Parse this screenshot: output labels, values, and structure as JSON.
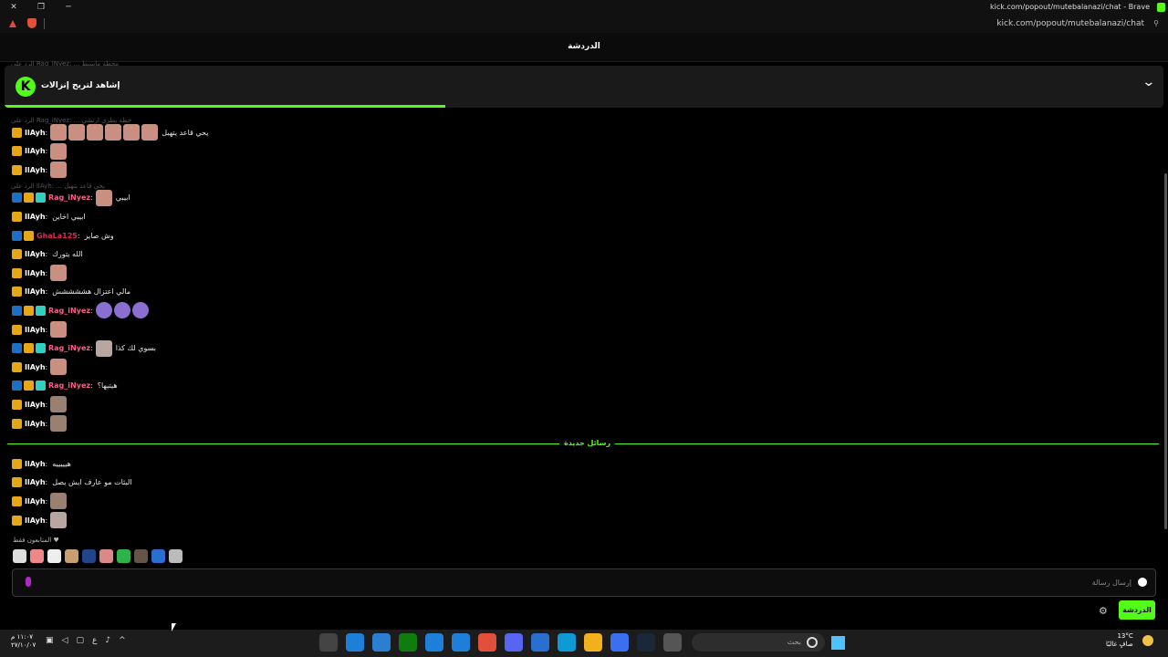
{
  "window": {
    "title": "kick.com/popout/mutebalanazi/chat - Brave",
    "close": "✕",
    "restore": "❐",
    "minimize": "─"
  },
  "browser": {
    "url": "kick.com/popout/mutebalanazi/chat"
  },
  "chat": {
    "header_title": "الدردشة",
    "banner_text": "إشاهد لتربح إنزالات",
    "banner_logo": "K",
    "banner_progress": 0.38,
    "ghost_reply_top": "الرد على Rag_iNyez: ... محطة ماسيط",
    "reply_to_1": "الرد على Rag_iNyez: ... خطه يطرى ارتشي",
    "reply_to_2": "الرد على IlAyh: ... يحي قاعد يتهبل",
    "messages": [
      {
        "user": "IlAyh",
        "color": "#ffffff",
        "text": "يحي قاعد يتهبل",
        "emotes": 6,
        "emote_type": "e1",
        "badges": [
          "crown"
        ]
      },
      {
        "user": "IlAyh",
        "color": "#ffffff",
        "text": "",
        "emotes": 1,
        "emote_type": "e1",
        "badges": [
          "crown"
        ]
      },
      {
        "user": "IlAyh",
        "color": "#ffffff",
        "text": "",
        "emotes": 1,
        "emote_type": "e1",
        "badges": [
          "crown"
        ]
      },
      {
        "user": "Rag_iNyez",
        "color": "#ff5c8a",
        "text": "ابيبي",
        "emotes": 1,
        "emote_type": "e1",
        "badges": [
          "mod",
          "crown",
          "sub"
        ]
      },
      {
        "user": "IlAyh",
        "color": "#ffffff",
        "text": "ابيبي اخاين",
        "emotes": 0,
        "emote_type": "e1",
        "badges": [
          "crown"
        ]
      },
      {
        "user": "GhaLa125",
        "color": "#e0245e",
        "text": "وش صاير",
        "emotes": 0,
        "emote_type": "e1",
        "badges": [
          "mod",
          "crown"
        ]
      },
      {
        "user": "IlAyh",
        "color": "#ffffff",
        "text": "الله يتورك",
        "emotes": 0,
        "emote_type": "e1",
        "badges": [
          "crown"
        ]
      },
      {
        "user": "IlAyh",
        "color": "#ffffff",
        "text": "",
        "emotes": 1,
        "emote_type": "e1",
        "badges": [
          "crown"
        ]
      },
      {
        "user": "IlAyh",
        "color": "#ffffff",
        "text": "مالي اعتزال هششششش",
        "emotes": 0,
        "emote_type": "e1",
        "badges": [
          "crown"
        ]
      },
      {
        "user": "Rag_iNyez",
        "color": "#ff5c8a",
        "text": "",
        "emotes": 3,
        "emote_type": "e3",
        "badges": [
          "mod",
          "crown",
          "sub"
        ]
      },
      {
        "user": "IlAyh",
        "color": "#ffffff",
        "text": "",
        "emotes": 1,
        "emote_type": "e1",
        "badges": [
          "crown"
        ]
      },
      {
        "user": "Rag_iNyez",
        "color": "#ff5c8a",
        "text": "بسوي لك كذا",
        "emotes": 1,
        "emote_type": "e4",
        "badges": [
          "mod",
          "crown",
          "sub"
        ]
      },
      {
        "user": "IlAyh",
        "color": "#ffffff",
        "text": "",
        "emotes": 1,
        "emote_type": "e1",
        "badges": [
          "crown"
        ]
      },
      {
        "user": "Rag_iNyez",
        "color": "#ff5c8a",
        "text": "هيتيها؟",
        "emotes": 0,
        "emote_type": "e1",
        "badges": [
          "mod",
          "crown",
          "sub"
        ]
      },
      {
        "user": "IlAyh",
        "color": "#ffffff",
        "text": "",
        "emotes": 1,
        "emote_type": "e2",
        "badges": [
          "crown"
        ]
      },
      {
        "user": "IlAyh",
        "color": "#ffffff",
        "text": "",
        "emotes": 1,
        "emote_type": "e2",
        "badges": [
          "crown"
        ]
      }
    ],
    "new_messages_label": "رسائل جديدة",
    "new_messages": [
      {
        "user": "IlAyh",
        "color": "#ffffff",
        "text": "هيييييه",
        "emotes": 0,
        "emote_type": "e1",
        "badges": [
          "crown"
        ]
      },
      {
        "user": "IlAyh",
        "color": "#ffffff",
        "text": "البثات مو عارف ايش يصل",
        "emotes": 0,
        "emote_type": "e1",
        "badges": [
          "crown"
        ]
      },
      {
        "user": "IlAyh",
        "color": "#ffffff",
        "text": "",
        "emotes": 1,
        "emote_type": "e2",
        "badges": [
          "crown"
        ]
      },
      {
        "user": "IlAyh",
        "color": "#ffffff",
        "text": "",
        "emotes": 1,
        "emote_type": "e4",
        "badges": [
          "crown"
        ]
      }
    ],
    "followers_only": "المتابعون فقط ♥",
    "emote_bar_colors": [
      "#dddddd",
      "#e88",
      "#eeeeee",
      "#c8a070",
      "#224488",
      "#d88",
      "#2db34a",
      "#665544",
      "#2a6fd0",
      "#bbb"
    ],
    "input_placeholder": "إرسال رسالة",
    "chat_button": "الدردشة",
    "settings_icon": "⚙"
  },
  "taskbar": {
    "time": "١١:٠٧ م",
    "date": "٢٧/١٠/٠٧",
    "search_placeholder": "بحث",
    "weather_temp": "13°C",
    "weather_desc": "صافٍ غالبًا",
    "lang": "ع",
    "tray_arrow": "^",
    "app_colors": [
      "#444",
      "#1e7fd8",
      "#2a7fd0",
      "#107c10",
      "#1e7fd8",
      "#1e7fd8",
      "#e0503a",
      "#5865f2",
      "#2a6fd0",
      "#0f9ad6",
      "#f2b01c",
      "#3a6ff0",
      "#1b2838",
      "#555"
    ]
  }
}
